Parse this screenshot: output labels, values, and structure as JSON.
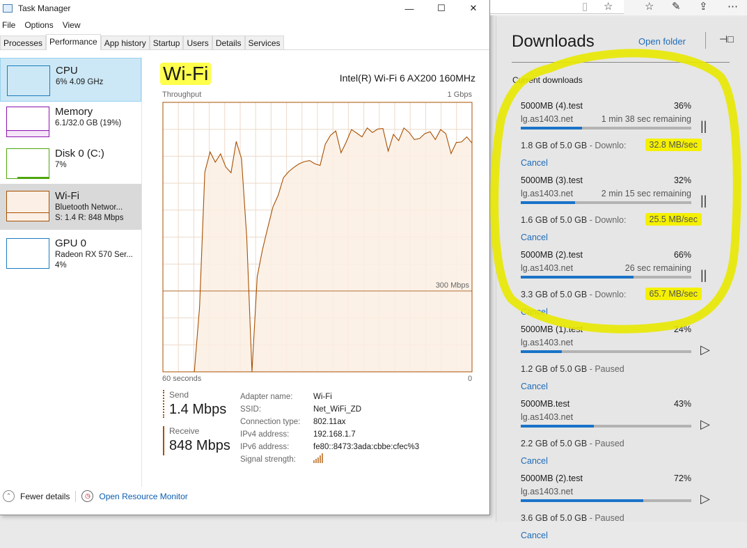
{
  "window": {
    "title": "Task Manager",
    "minimize": "—",
    "maximize": "☐",
    "close": "✕"
  },
  "menu": [
    "File",
    "Options",
    "View"
  ],
  "tabs": [
    "Processes",
    "Performance",
    "App history",
    "Startup",
    "Users",
    "Details",
    "Services"
  ],
  "active_tab": "Performance",
  "resources": [
    {
      "name": "CPU",
      "line1": "6% 4.09 GHz",
      "line2": "",
      "color": "#1c7bbd"
    },
    {
      "name": "Memory",
      "line1": "6.1/32.0 GB (19%)",
      "line2": "",
      "color": "#8b12ae"
    },
    {
      "name": "Disk 0 (C:)",
      "line1": "7%",
      "line2": "",
      "color": "#4da60c"
    },
    {
      "name": "Wi-Fi",
      "line1": "Bluetooth Networ...",
      "line2": "S: 1.4 R: 848 Mbps",
      "color": "#a74f01"
    },
    {
      "name": "GPU 0",
      "line1": "Radeon RX 570 Ser...",
      "line2": "4%",
      "color": "#1c7bbd"
    }
  ],
  "detail": {
    "title": "Wi-Fi",
    "adapter": "Intel(R) Wi-Fi 6 AX200 160MHz",
    "send_label": "Send",
    "send_value": "1.4 Mbps",
    "receive_label": "Receive",
    "receive_value": "848 Mbps",
    "props": [
      [
        "Adapter name:",
        "Wi-Fi"
      ],
      [
        "SSID:",
        "Net_WiFi_ZD"
      ],
      [
        "Connection type:",
        "802.11ax"
      ],
      [
        "IPv4 address:",
        "192.168.1.7"
      ],
      [
        "IPv6 address:",
        "fe80::8473:3ada:cbbe:cfec%3"
      ],
      [
        "Signal strength:",
        ""
      ]
    ],
    "signal_bars": 5
  },
  "chart_data": {
    "type": "area",
    "title": "Throughput",
    "xlabel_left": "60 seconds",
    "xlabel_right": "0",
    "ymax_label": "1 Gbps",
    "ref_label": "300 Mbps",
    "ref_value": 300,
    "ylim": [
      0,
      1000
    ],
    "unit": "Mbps",
    "color": "#a74f01",
    "values": [
      0,
      0,
      0,
      0,
      0,
      0,
      0,
      241,
      741,
      816,
      778,
      809,
      760,
      739,
      855,
      791,
      500,
      0,
      353,
      453,
      534,
      612,
      655,
      720,
      743,
      759,
      772,
      780,
      784,
      772,
      766,
      845,
      878,
      894,
      813,
      853,
      899,
      886,
      872,
      905,
      888,
      901,
      903,
      819,
      881,
      858,
      905,
      888,
      862,
      866,
      884,
      891,
      862,
      899,
      884,
      810,
      851,
      853,
      872,
      849
    ]
  },
  "footer": {
    "fewer": "Fewer details",
    "resmon": "Open Resource Monitor"
  },
  "downloads": {
    "title": "Downloads",
    "open_folder": "Open folder",
    "section": "Current downloads",
    "cancel": "Cancel",
    "items": [
      {
        "name": "5000MB (4).test",
        "percent": "36%",
        "progress": 36,
        "host": "lg.as1403.net",
        "remaining": "1 min 38 sec remaining",
        "size": "1.8 GB of 5.0 GB",
        "status": "- Downlo:",
        "speed": "32.8 MB/sec",
        "state": "downloading"
      },
      {
        "name": "5000MB (3).test",
        "percent": "32%",
        "progress": 32,
        "host": "lg.as1403.net",
        "remaining": "2 min 15 sec remaining",
        "size": "1.6 GB of 5.0 GB",
        "status": "- Downlo:",
        "speed": "25.5 MB/sec",
        "state": "downloading"
      },
      {
        "name": "5000MB (2).test",
        "percent": "66%",
        "progress": 66,
        "host": "lg.as1403.net",
        "remaining": "26 sec remaining",
        "size": "3.3 GB of 5.0 GB",
        "status": "- Downlo:",
        "speed": "65.7 MB/sec",
        "state": "downloading"
      },
      {
        "name": "5000MB (1).test",
        "percent": "24%",
        "progress": 24,
        "host": "lg.as1403.net",
        "remaining": "",
        "size": "1.2 GB of 5.0 GB",
        "status": "- Paused",
        "speed": "",
        "state": "paused"
      },
      {
        "name": "5000MB.test",
        "percent": "43%",
        "progress": 43,
        "host": "lg.as1403.net",
        "remaining": "",
        "size": "2.2 GB of 5.0 GB",
        "status": "- Paused",
        "speed": "",
        "state": "paused"
      },
      {
        "name": "5000MB (2).test",
        "percent": "72%",
        "progress": 72,
        "host": "lg.as1403.net",
        "remaining": "",
        "size": "3.6 GB of 5.0 GB",
        "status": "- Paused",
        "speed": "",
        "state": "paused"
      }
    ]
  },
  "annotation_color": "#e8e800"
}
